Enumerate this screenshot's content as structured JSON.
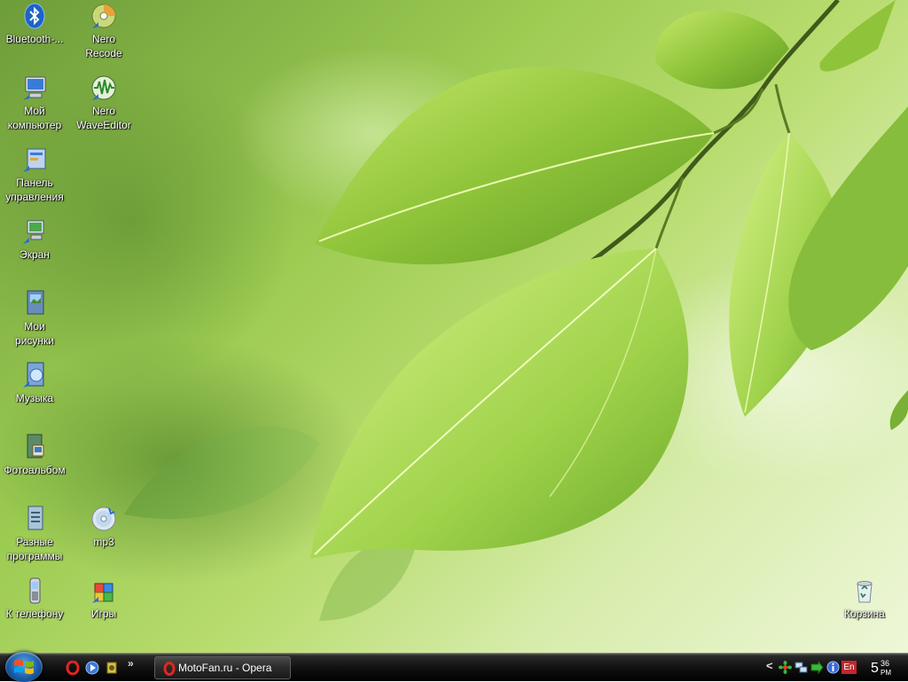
{
  "desktop": {
    "icons": [
      {
        "label": "Bluetooth-...",
        "icon": "bluetooth-icon"
      },
      {
        "label": "Мой\nкомпьютер",
        "icon": "computer-icon"
      },
      {
        "label": "Панель\nуправления",
        "icon": "control-panel-icon"
      },
      {
        "label": "Экран",
        "icon": "display-icon"
      },
      {
        "label": "Мои\nрисунки",
        "icon": "pictures-folder-icon"
      },
      {
        "label": "Музыка",
        "icon": "music-folder-icon"
      },
      {
        "label": "Фотоальбом",
        "icon": "photo-album-icon"
      },
      {
        "label": "Разные\nпрограммы",
        "icon": "programs-folder-icon"
      },
      {
        "label": "К телефону",
        "icon": "phone-icon"
      },
      {
        "label": "Nero\nRecode",
        "icon": "nero-recode-icon"
      },
      {
        "label": "Nero\nWaveEditor",
        "icon": "nero-waveeditor-icon"
      },
      {
        "label": "mp3",
        "icon": "cd-icon"
      },
      {
        "label": "Игры",
        "icon": "games-icon"
      },
      {
        "label": "Корзина",
        "icon": "recycle-bin-icon"
      }
    ]
  },
  "taskbar": {
    "quicklaunch_more": "»",
    "tasks": [
      {
        "label": "MotoFan.ru - Opera",
        "icon": "opera-icon"
      }
    ],
    "tray": {
      "expand": "<",
      "language": "En"
    },
    "clock": {
      "hour": "5",
      "minutes": "36",
      "ampm": "PM"
    }
  }
}
